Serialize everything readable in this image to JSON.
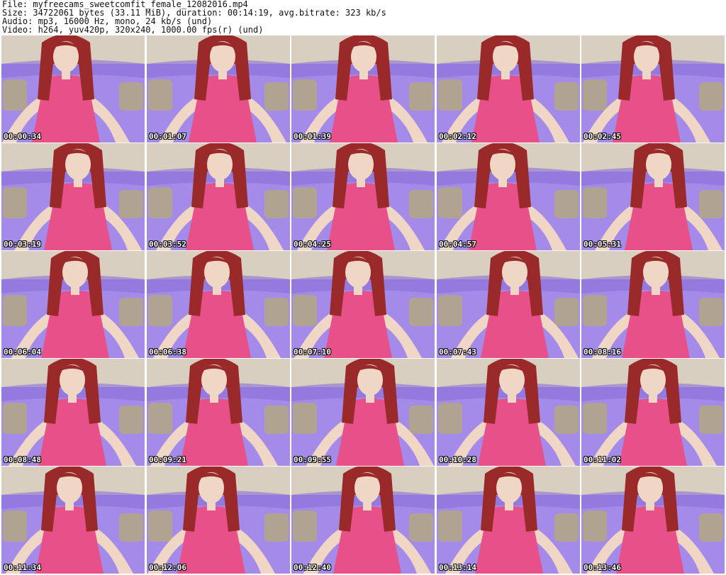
{
  "header": {
    "file_line": "File: myfreecams_sweetcomfit_female_12082016.mp4",
    "size_line": "Size: 34722061 bytes (33.11 MiB), duration: 00:14:19, avg.bitrate: 323 kb/s",
    "audio_line": "Audio: mp3, 16000 Hz, mono, 24 kb/s (und)",
    "video_line": "Video: h264, yuv420p, 320x240, 1000.00 fps(r) (und)"
  },
  "colors": {
    "sofa": "#a48ae9",
    "sofa_dark": "#8a6fd8",
    "wall": "#d9cfc0",
    "pillow": "#b0a392",
    "dress": "#e8508a",
    "hair": "#9a2a2a",
    "skin": "#f0d6c4"
  },
  "thumbnails": [
    {
      "timestamp": "00:00:34"
    },
    {
      "timestamp": "00:01:07"
    },
    {
      "timestamp": "00:01:39"
    },
    {
      "timestamp": "00:02:12"
    },
    {
      "timestamp": "00:02:45"
    },
    {
      "timestamp": "00:03:19"
    },
    {
      "timestamp": "00:03:52"
    },
    {
      "timestamp": "00:04:25"
    },
    {
      "timestamp": "00:04:57"
    },
    {
      "timestamp": "00:05:31"
    },
    {
      "timestamp": "00:06:04"
    },
    {
      "timestamp": "00:06:38"
    },
    {
      "timestamp": "00:07:10"
    },
    {
      "timestamp": "00:07:43"
    },
    {
      "timestamp": "00:08:16"
    },
    {
      "timestamp": "00:08:48"
    },
    {
      "timestamp": "00:09:21"
    },
    {
      "timestamp": "00:09:55"
    },
    {
      "timestamp": "00:10:28"
    },
    {
      "timestamp": "00:11:02"
    },
    {
      "timestamp": "00:11:34"
    },
    {
      "timestamp": "00:12:06"
    },
    {
      "timestamp": "00:12:40"
    },
    {
      "timestamp": "00:13:14"
    },
    {
      "timestamp": "00:13:46"
    }
  ]
}
